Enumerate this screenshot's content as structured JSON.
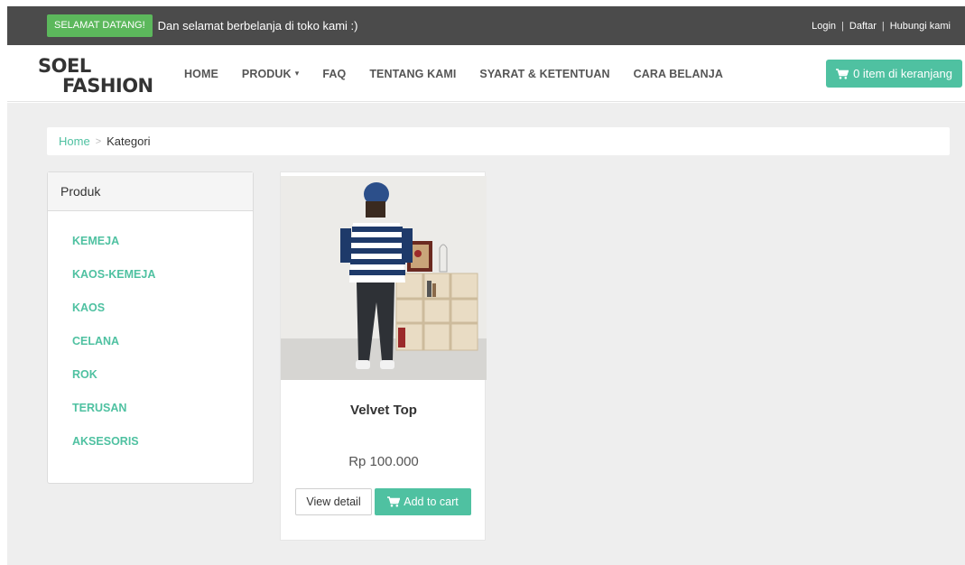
{
  "topbar": {
    "welcome_badge": "SELAMAT DATANG!",
    "welcome_text": "Dan selamat berbelanja di toko kami :)",
    "links": [
      "Login",
      "Daftar",
      "Hubungi kami"
    ]
  },
  "navbar": {
    "logo_line1": "SOEL",
    "logo_line2": "FASHION",
    "menu": [
      "HOME",
      "PRODUK",
      "FAQ",
      "TENTANG KAMI",
      "SYARAT & KETENTUAN",
      "CARA BELANJA"
    ],
    "cart_label": "0 item di keranjang"
  },
  "breadcrumb": {
    "home": "Home",
    "separator": ">",
    "current": "Kategori"
  },
  "sidebar": {
    "title": "Produk",
    "items": [
      "KEMEJA",
      "KAOS-KEMEJA",
      "KAOS",
      "CELANA",
      "ROK",
      "TERUSAN",
      "AKSESORIS"
    ]
  },
  "product": {
    "name": "Velvet Top",
    "price": "Rp 100.000",
    "view_detail": "View detail",
    "add_to_cart": "Add to cart"
  },
  "colors": {
    "accent": "#4fc1a1",
    "topbar_bg": "#4b4b4b",
    "welcome_badge_bg": "#5cb85c",
    "page_bg": "#eeeeee"
  },
  "icons": {
    "cart": "shopping-cart-icon",
    "dropdown": "caret-down-icon"
  }
}
